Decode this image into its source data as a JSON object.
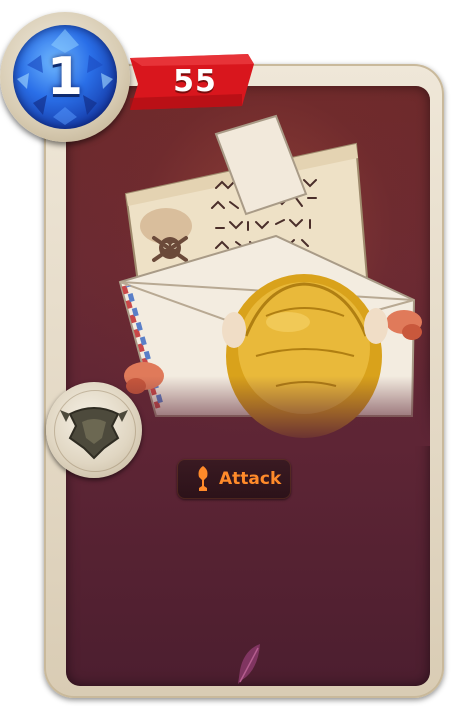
{
  "card": {
    "mana_cost": "1",
    "stat_value": "55",
    "keyword": {
      "label": "Attack",
      "icon": "sword-icon"
    },
    "faction_icon": "crest-icon",
    "rarity_icon": "feather-icon",
    "artwork": "envelope-letter-art"
  },
  "colors": {
    "mana_gem": "#2a6fe8",
    "stat_banner": "#d9161d",
    "card_background": "#5e2535",
    "frame": "#e8dfcd",
    "keyword_text": "#ff8a2a"
  }
}
